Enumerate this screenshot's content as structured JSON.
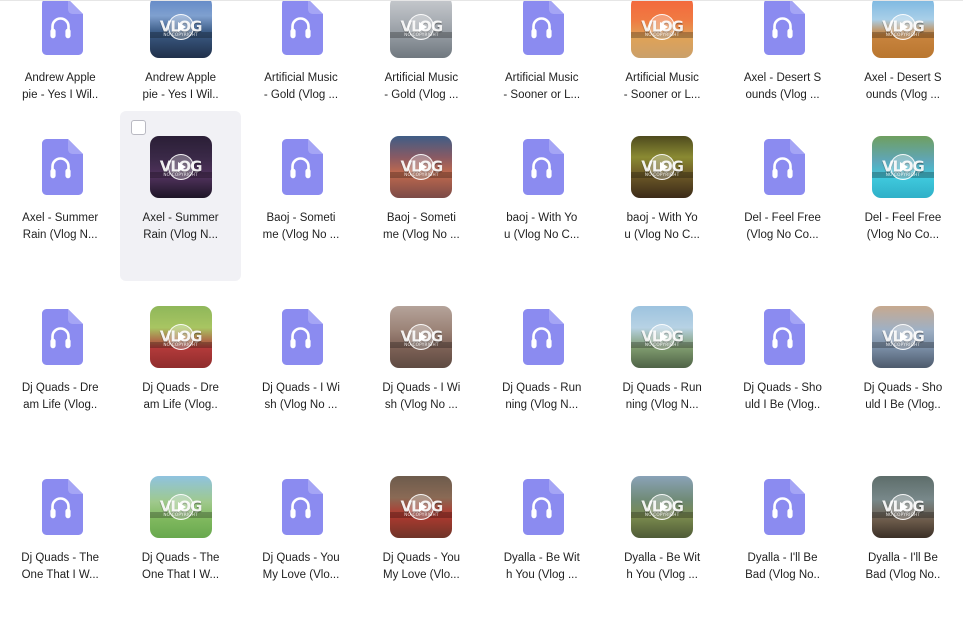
{
  "view": {
    "type": "file-explorer-grid",
    "columns": 8,
    "rows": 4,
    "background_color": "#ffffff",
    "hover_background_color": "#f1f1f5",
    "audio_icon_color": "#8b8bf0",
    "text_color": "#1f1f1f",
    "thumbnail_overlay_text": "VLOG",
    "thumbnail_overlay_subtext": "NO COPYRIGHT"
  },
  "rows": [
    {
      "cells": [
        {
          "icon": "audio-file-icon",
          "label": "Andrew Apple\npie - Yes I Wil..",
          "selected": false
        },
        {
          "icon": "video-thumbnail",
          "label": "Andrew Apple\npie - Yes I Wil..",
          "thumb_gradient": "linear-gradient(180deg,#5f86c6 0%,#7fa0cf 32%,#3c5c86 58%,#20304a 100%)",
          "selected": false
        },
        {
          "icon": "audio-file-icon",
          "label": "Artificial Music\n- Gold (Vlog ...",
          "selected": false
        },
        {
          "icon": "video-thumbnail",
          "label": "Artificial Music\n- Gold (Vlog ...",
          "thumb_gradient": "linear-gradient(180deg,#c9ccd0 0%,#a9aeb4 40%,#8d949b 70%,#70787f 100%)",
          "selected": false
        },
        {
          "icon": "audio-file-icon",
          "label": "Artificial Music\n- Sooner or L...",
          "selected": false
        },
        {
          "icon": "video-thumbnail",
          "label": "Artificial Music\n- Sooner or L...",
          "thumb_gradient": "linear-gradient(180deg,#f4653c 0%,#f07a42 38%,#e0a257 66%,#caa06a 100%)",
          "selected": false
        },
        {
          "icon": "audio-file-icon",
          "label": "Axel - Desert S\nounds (Vlog ...",
          "selected": false
        },
        {
          "icon": "video-thumbnail",
          "label": "Axel - Desert S\nounds (Vlog ...",
          "thumb_gradient": "linear-gradient(180deg,#76b4e0 0%,#a9cfe8 38%,#c9853f 62%,#b9762f 100%)",
          "selected": false
        }
      ]
    },
    {
      "cells": [
        {
          "icon": "audio-file-icon",
          "label": "Axel - Summer\nRain (Vlog N...",
          "selected": false
        },
        {
          "icon": "video-thumbnail",
          "label": "Axel - Summer\nRain (Vlog N...",
          "thumb_gradient": "linear-gradient(180deg,#2a1e36 0%,#3a2947 35%,#50325c 65%,#1d1526 100%)",
          "selected": true
        },
        {
          "icon": "audio-file-icon",
          "label": "Baoj - Someti\nme (Vlog No ...",
          "selected": false
        },
        {
          "icon": "video-thumbnail",
          "label": "Baoj - Someti\nme (Vlog No ...",
          "thumb_gradient": "linear-gradient(180deg,#3f5d86 0%,#8a5a63 35%,#c06a4e 60%,#7b4a47 100%)",
          "selected": false
        },
        {
          "icon": "audio-file-icon",
          "label": "baoj - With Yo\nu (Vlog No C...",
          "selected": false
        },
        {
          "icon": "video-thumbnail",
          "label": "baoj - With Yo\nu (Vlog No C...",
          "thumb_gradient": "linear-gradient(180deg,#4e4a1e 0%,#8a8a32 34%,#6e5b28 62%,#3b2a18 100%)",
          "selected": false
        },
        {
          "icon": "audio-file-icon",
          "label": "Del - Feel Free\n(Vlog No Co...",
          "selected": false
        },
        {
          "icon": "video-thumbnail",
          "label": "Del - Feel Free\n(Vlog No Co...",
          "thumb_gradient": "linear-gradient(180deg,#6f9f5f 0%,#5fa6b8 40%,#3fc8dc 68%,#2fb0c8 100%)",
          "selected": false
        }
      ]
    },
    {
      "cells": [
        {
          "icon": "audio-file-icon",
          "label": "Dj Quads - Dre\nam Life (Vlog..",
          "selected": false
        },
        {
          "icon": "video-thumbnail",
          "label": "Dj Quads - Dre\nam Life (Vlog..",
          "thumb_gradient": "linear-gradient(180deg,#8fb75a 0%,#a8c562 35%,#b23a3a 68%,#8f2c2c 100%)",
          "selected": false
        },
        {
          "icon": "audio-file-icon",
          "label": "Dj Quads - I Wi\nsh (Vlog No ...",
          "selected": false
        },
        {
          "icon": "video-thumbnail",
          "label": "Dj Quads - I Wi\nsh (Vlog No ...",
          "thumb_gradient": "linear-gradient(180deg,#b5a39a 0%,#9c8478 38%,#7e6257 66%,#5e4a42 100%)",
          "selected": false
        },
        {
          "icon": "audio-file-icon",
          "label": "Dj Quads - Run\nning (Vlog N...",
          "selected": false
        },
        {
          "icon": "video-thumbnail",
          "label": "Dj Quads - Run\nning (Vlog N...",
          "thumb_gradient": "linear-gradient(180deg,#9dc3df 0%,#b7d2e4 35%,#7e9a6e 68%,#4e6246 100%)",
          "selected": false
        },
        {
          "icon": "audio-file-icon",
          "label": "Dj Quads - Sho\nuld I Be (Vlog..",
          "selected": false
        },
        {
          "icon": "video-thumbnail",
          "label": "Dj Quads - Sho\nuld I Be (Vlog..",
          "thumb_gradient": "linear-gradient(180deg,#c7a98f 0%,#9fb0c4 38%,#7c90a8 66%,#4d5a6c 100%)",
          "selected": false
        }
      ]
    },
    {
      "cells": [
        {
          "icon": "audio-file-icon",
          "label": "Dj Quads - The\nOne That I W...",
          "selected": false
        },
        {
          "icon": "video-thumbnail",
          "label": "Dj Quads - The\nOne That I W...",
          "thumb_gradient": "linear-gradient(180deg,#8fc3e0 0%,#9fc98c 42%,#7fb85e 70%,#68a84e 100%)",
          "selected": false
        },
        {
          "icon": "audio-file-icon",
          "label": "Dj Quads - You\nMy Love (Vlo...",
          "selected": false
        },
        {
          "icon": "video-thumbnail",
          "label": "Dj Quads - You\nMy Love (Vlo...",
          "thumb_gradient": "linear-gradient(180deg,#6d5b4c 0%,#8a6a55 35%,#b03a30 62%,#6e3428 100%)",
          "selected": false
        },
        {
          "icon": "audio-file-icon",
          "label": "Dyalla - Be Wit\nh You (Vlog ...",
          "selected": false
        },
        {
          "icon": "video-thumbnail",
          "label": "Dyalla - Be Wit\nh You (Vlog ...",
          "thumb_gradient": "linear-gradient(180deg,#8aa3b8 0%,#6f8a74 40%,#7a8a4e 66%,#4e5a36 100%)",
          "selected": false
        },
        {
          "icon": "audio-file-icon",
          "label": "Dyalla - I'll Be\nBad (Vlog No..",
          "selected": false
        },
        {
          "icon": "video-thumbnail",
          "label": "Dyalla - I'll Be\nBad (Vlog No..",
          "thumb_gradient": "linear-gradient(180deg,#5d6d6a 0%,#78888a 38%,#6b5a4a 72%,#3a2f26 100%)",
          "selected": false
        }
      ]
    }
  ]
}
